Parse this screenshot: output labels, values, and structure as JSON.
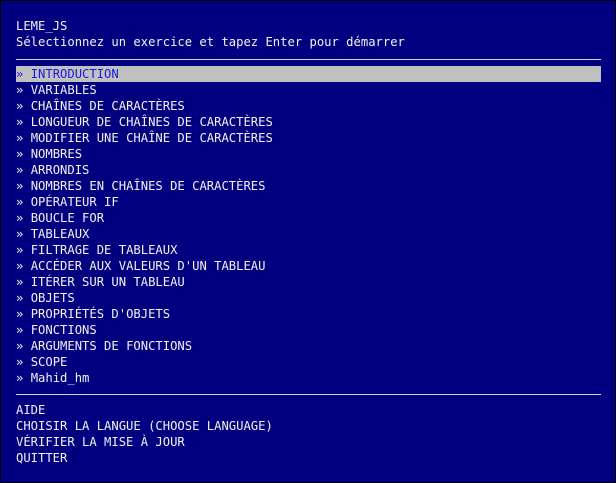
{
  "colors": {
    "background": "#010080",
    "text": "#f2f2f2",
    "selection_background": "#c0c0c0",
    "selection_text": "#1a1ae0",
    "rule": "#d8d8d8"
  },
  "header": {
    "title": "LEME_JS",
    "subtitle": "Sélectionnez un exercice et tapez Enter pour démarrer"
  },
  "menu": {
    "bullet": "»",
    "selected_index": 0,
    "items": [
      {
        "label": "INTRODUCTION"
      },
      {
        "label": "VARIABLES"
      },
      {
        "label": "CHAÎNES DE CARACTÈRES"
      },
      {
        "label": "LONGUEUR DE CHAÎNES DE CARACTÈRES"
      },
      {
        "label": "MODIFIER UNE CHAÎNE DE CARACTÈRES"
      },
      {
        "label": "NOMBRES"
      },
      {
        "label": "ARRONDIS"
      },
      {
        "label": "NOMBRES EN CHAÎNES DE CARACTÈRES"
      },
      {
        "label": "OPÉRATEUR IF"
      },
      {
        "label": "BOUCLE FOR"
      },
      {
        "label": "TABLEAUX"
      },
      {
        "label": "FILTRAGE DE TABLEAUX"
      },
      {
        "label": "ACCÉDER AUX VALEURS D'UN TABLEAU"
      },
      {
        "label": "ITÉRER SUR UN TABLEAU"
      },
      {
        "label": "OBJETS"
      },
      {
        "label": "PROPRIÉTÉS D'OBJETS"
      },
      {
        "label": "FONCTIONS"
      },
      {
        "label": "ARGUMENTS DE FONCTIONS"
      },
      {
        "label": "SCOPE"
      },
      {
        "label": "Mahid_hm"
      }
    ]
  },
  "footer": {
    "items": [
      {
        "label": "AIDE"
      },
      {
        "label": "CHOISIR LA LANGUE (CHOOSE LANGUAGE)"
      },
      {
        "label": "VÉRIFIER LA MISE À JOUR"
      },
      {
        "label": "QUITTER"
      }
    ]
  }
}
